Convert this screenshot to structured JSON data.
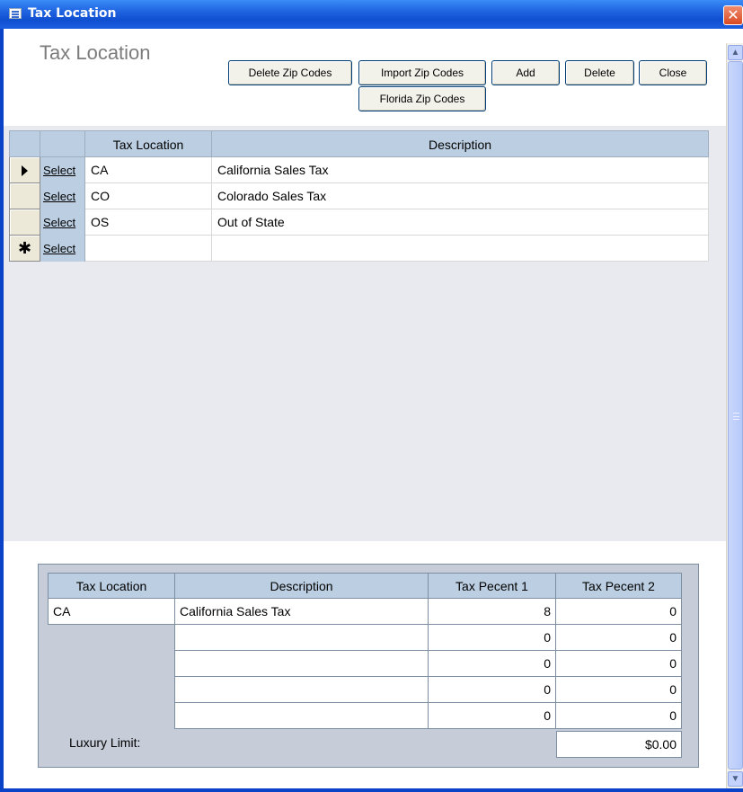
{
  "window": {
    "title": "Tax Location",
    "close_glyph": "✕"
  },
  "form": {
    "title": "Tax Location",
    "buttons": {
      "delete_zip": "Delete Zip Codes",
      "import_zip": "Import Zip Codes",
      "add": "Add",
      "delete": "Delete",
      "close": "Close",
      "florida_zip": "Florida Zip Codes"
    }
  },
  "datasheet": {
    "columns": [
      "Tax Location",
      "Description"
    ],
    "link_label": "Select",
    "rows": [
      {
        "code": "CA",
        "description": "California Sales Tax",
        "current": true
      },
      {
        "code": "CO",
        "description": "Colorado Sales Tax"
      },
      {
        "code": "OS",
        "description": "Out of State"
      },
      {
        "code": "",
        "description": "",
        "new": true
      }
    ]
  },
  "detail": {
    "columns": [
      "Tax Location",
      "Description",
      "Tax Pecent 1",
      "Tax Pecent 2"
    ],
    "rows": [
      {
        "code": "CA",
        "description": "California Sales Tax",
        "pct1": "8",
        "pct2": "0"
      },
      {
        "description": "",
        "pct1": "0",
        "pct2": "0"
      },
      {
        "description": "",
        "pct1": "0",
        "pct2": "0"
      },
      {
        "description": "",
        "pct1": "0",
        "pct2": "0"
      },
      {
        "description": "",
        "pct1": "0",
        "pct2": "0"
      }
    ],
    "luxury_label": "Luxury Limit:",
    "luxury_value": "$0.00"
  },
  "icons": {
    "window_icon": "form-icon",
    "row_current": "record-pointer-icon",
    "row_new": "new-record-icon"
  },
  "colors": {
    "title_bar": "#1f63e0",
    "header_row": "#bccfe2",
    "panel": "#c6cdd9"
  }
}
